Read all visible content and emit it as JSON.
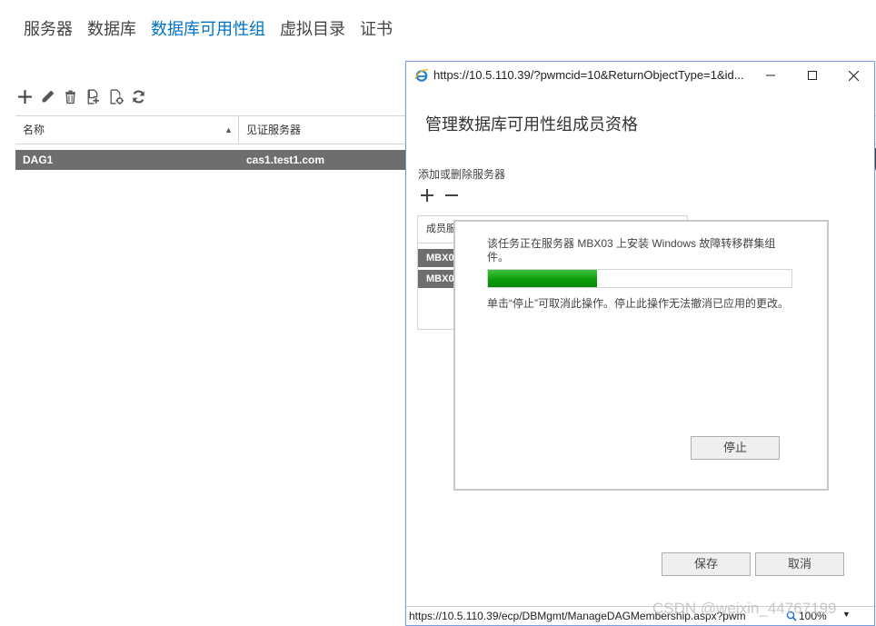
{
  "top_nav": {
    "items": [
      {
        "label": "服务器",
        "active": false
      },
      {
        "label": "数据库",
        "active": false
      },
      {
        "label": "数据库可用性组",
        "active": true
      },
      {
        "label": "虚拟目录",
        "active": false
      },
      {
        "label": "证书",
        "active": false
      }
    ],
    "active_color": "#0072c6"
  },
  "toolbar": {
    "icons": [
      "plus-icon",
      "pencil-icon",
      "trash-icon",
      "add-server-icon",
      "manage-network-icon",
      "refresh-icon"
    ]
  },
  "grid": {
    "columns": [
      "名称",
      "见证服务器"
    ],
    "sort_indicator": "▲",
    "rows": [
      {
        "name": "DAG1",
        "witness": "cas1.test1.com"
      }
    ]
  },
  "popup": {
    "window_title": "https://10.5.110.39/?pwmcid=10&ReturnObjectType=1&id...",
    "dialog_title": "管理数据库可用性组成员资格",
    "section_label": "添加或删除服务器",
    "members_header": "成员服",
    "members": [
      "MBX0",
      "MBX0"
    ],
    "save_label": "保存",
    "cancel_label": "取消",
    "status_url": "https://10.5.110.39/ecp/DBMgmt/ManageDAGMembership.aspx?pwm",
    "zoom": "100%"
  },
  "progress_dialog": {
    "message": "该任务正在服务器 MBX03 上安装 Windows 故障转移群集组件。",
    "progress_fraction": 0.36,
    "hint": "单击“停止”可取消此操作。停止此操作无法撤消已应用的更改。",
    "stop_label": "停止",
    "bar_color": "#0c9e0c"
  },
  "watermark": "CSDN @weixin_44767199"
}
